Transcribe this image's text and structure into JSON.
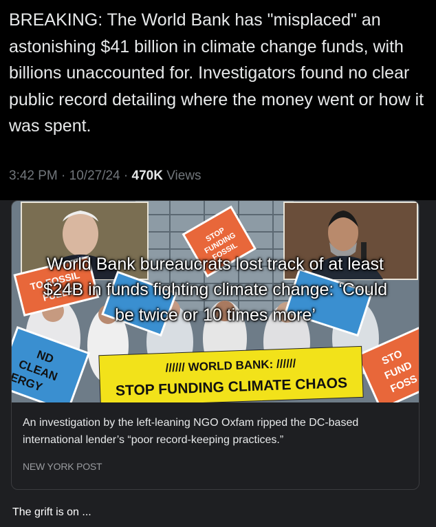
{
  "tweet": {
    "text": "BREAKING: The World Bank has \"misplaced\" an astonishing $41 billion in climate change funds, with billions unaccounted for. Investigators found no clear public record detailing where the money went or how it was spent.",
    "time": "3:42 PM",
    "separator": "·",
    "date": "10/27/24",
    "views_count": "470K",
    "views_label": "Views"
  },
  "card": {
    "image_headline": "World Bank bureaucrats lost track of at least $24B in funds fighting climate change: ‘Could be twice or 10 times more’",
    "banner_top": "////// WORLD BANK: //////",
    "banner_bottom": "STOP FUNDING CLIMATE CHAOS",
    "sign_left": "ND CLEAN ERGY",
    "sign_right": "STO FUND FOSS",
    "sign_top_left": "TO FOSSIL FUELS",
    "sign_top_center": "STOP FUNDING FOSSIL",
    "description": "An investigation by the left-leaning NGO Oxfam ripped the DC-based international lender’s “poor record-keeping practices.”",
    "source": "NEW YORK POST"
  },
  "reply": {
    "text": "The grift is on ..."
  },
  "colors": {
    "top_background": "#000000",
    "bottom_background": "#1e1f22",
    "text_primary": "#e7e9ea",
    "text_secondary": "#71767b",
    "banner_yellow": "#f2e21a",
    "sign_orange": "#e8673a",
    "sign_blue": "#3a8fd0"
  }
}
